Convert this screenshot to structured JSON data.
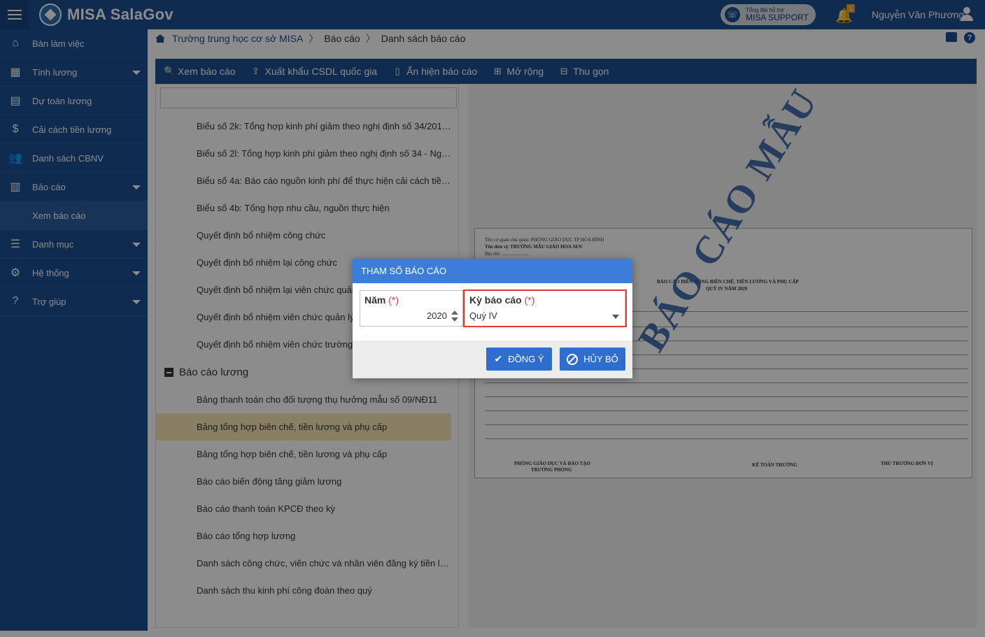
{
  "app": {
    "title": "MISA SalaGov"
  },
  "support": {
    "small": "Tổng đài hỗ trợ",
    "big": "MISA SUPPORT"
  },
  "notifications": {
    "count": "1"
  },
  "user": {
    "name": "Nguyễn Văn Phương"
  },
  "sidebar": {
    "items": [
      {
        "label": "Bàn làm việc",
        "icon": "home-icon"
      },
      {
        "label": "Tính lương",
        "icon": "calculator-icon",
        "expandable": true
      },
      {
        "label": "Dự toán lương",
        "icon": "estimate-icon"
      },
      {
        "label": "Cải cách tiền lương",
        "icon": "dollar-icon"
      },
      {
        "label": "Danh sách CBNV",
        "icon": "users-icon"
      },
      {
        "label": "Báo cáo",
        "icon": "report-icon",
        "expandable": true
      },
      {
        "label": "Xem báo cáo",
        "sub": true
      },
      {
        "label": "Danh mục",
        "icon": "list-icon",
        "expandable": true
      },
      {
        "label": "Hệ thống",
        "icon": "gear-icon",
        "expandable": true
      },
      {
        "label": "Trợ giúp",
        "icon": "help-icon",
        "expandable": true
      }
    ]
  },
  "breadcrumb": {
    "items": [
      "Trường trung học cơ sở MISA",
      "Báo cáo",
      "Danh sách báo cáo"
    ]
  },
  "toolbar": {
    "view": "Xem báo cáo",
    "export": "Xuất khẩu CSDL quốc gia",
    "toggle": "Ẩn hiện báo cáo",
    "expand": "Mở rộng",
    "collapse": "Thu gọn"
  },
  "report_list": {
    "items_top": [
      "Biểu số 2k: Tổng hợp kinh phí giảm theo nghị định số 34/2019...",
      "Biểu số 2l: Tổng hợp kinh phí giảm theo nghị định số 34 - Ngư...",
      "Biểu số 4a: Báo cáo nguồn kinh phí để thực hiện cải cách tiền l...",
      "Biểu số 4b: Tổng hợp nhu cầu, nguồn thực hiện",
      "Quyết định bổ nhiệm công chức",
      "Quyết định bổ nhiệm lại công chức",
      "Quyết định bổ nhiệm lại viên chức quản lý",
      "Quyết định bổ nhiệm viên chức quản lý",
      "Quyết định bổ nhiệm viên chức trường"
    ],
    "group": "Báo cáo lương",
    "items_group": [
      "Bảng thanh toán cho đối tượng thụ hưởng mẫu số 09/NĐ11",
      "Bảng tổng hợp biên chế, tiền lương và phụ cấp",
      "Bảng tổng hợp biên chế, tiền lương và phụ cấp",
      "Báo cáo biến động tăng giảm lương",
      "Báo cáo thanh toán KPCĐ theo kỳ",
      "Báo cáo tổng hợp lương",
      "Danh sách công chức, viên chức và nhân viên đăng ký tiền lươ...",
      "Danh sách thu kinh phí công đoàn theo quý"
    ],
    "selected_index": 1
  },
  "preview": {
    "watermark": "BÁO CÁO MẪU",
    "org_line1": "Tên cơ quan chủ quản: PHÒNG GIÁO DỤC TP HÒA BÌNH",
    "org_line2": "Tên đơn vị: TRƯỜNG MẪU GIÁO HOA SEN",
    "org_line3": "Địa chỉ: ......................",
    "report_title": "BÁO CÁO BIẾN ĐỘNG BIÊN CHẾ, TIỀN LƯƠNG VÀ PHỤ CẤP",
    "report_subtitle": "QUÝ IV NĂM 2020",
    "sign1": "PHÒNG GIÁO DỤC VÀ ĐÀO TẠO",
    "sign1b": "TRƯỞNG PHÒNG",
    "sign2": "KẾ TOÁN TRƯỞNG",
    "sign3": "THỦ TRƯỞNG ĐƠN VỊ"
  },
  "dialog": {
    "title": "THAM SỐ BÁO CÁO",
    "year_label": "Năm",
    "required_mark": "(*)",
    "year_value": "2020",
    "period_label": "Kỳ báo cáo",
    "period_value": "Quý IV",
    "ok_label": "ĐỒNG Ý",
    "cancel_label": "HỦY BỎ"
  },
  "colors": {
    "primary": "#1d4f91",
    "dialog_header": "#3b7dd8",
    "button": "#2f6ecf",
    "highlight": "#e53935",
    "selected_row": "#f7e7b6"
  }
}
